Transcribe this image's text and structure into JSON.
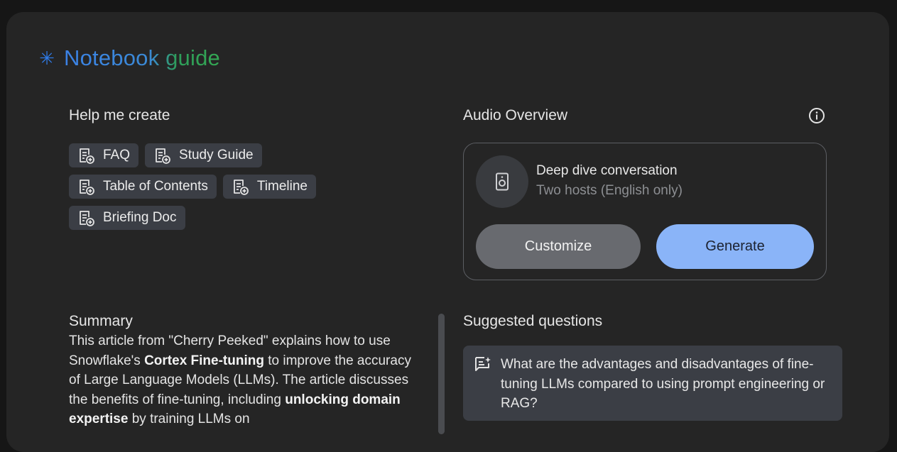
{
  "header": {
    "title": "Notebook guide"
  },
  "help_create": {
    "title": "Help me create",
    "chips": [
      [
        "FAQ",
        "Study Guide"
      ],
      [
        "Table of Contents",
        "Timeline"
      ],
      [
        "Briefing Doc"
      ]
    ]
  },
  "audio_overview": {
    "title": "Audio Overview",
    "card_title": "Deep dive conversation",
    "card_subtitle": "Two hosts (English only)",
    "customize_label": "Customize",
    "generate_label": "Generate"
  },
  "summary": {
    "title": "Summary",
    "segments": [
      {
        "text": "This article from \"Cherry Peeked\" explains how to use Snowflake's ",
        "bold": false
      },
      {
        "text": "Cortex Fine-tuning",
        "bold": true
      },
      {
        "text": " to improve the accuracy of Large Language Models (LLMs). The article discusses the benefits of fine-tuning, including ",
        "bold": false
      },
      {
        "text": "unlocking domain expertise",
        "bold": true
      },
      {
        "text": " by training LLMs on",
        "bold": false
      }
    ]
  },
  "suggested_questions": {
    "title": "Suggested questions",
    "items": [
      "What are the advantages and disadvantages of fine-tuning LLMs compared to using prompt engineering or RAG?"
    ]
  },
  "colors": {
    "background": "#252525",
    "chip": "#3b3e45",
    "generate": "#8ab4f8",
    "customize": "#686a6f",
    "title_blue": "#3b82e6",
    "title_green": "#34a853"
  },
  "icons": {
    "title": "sparkle-icon",
    "chip": "note-add-icon",
    "info": "info-icon",
    "speaker": "speaker-icon",
    "question": "chat-question-icon"
  }
}
